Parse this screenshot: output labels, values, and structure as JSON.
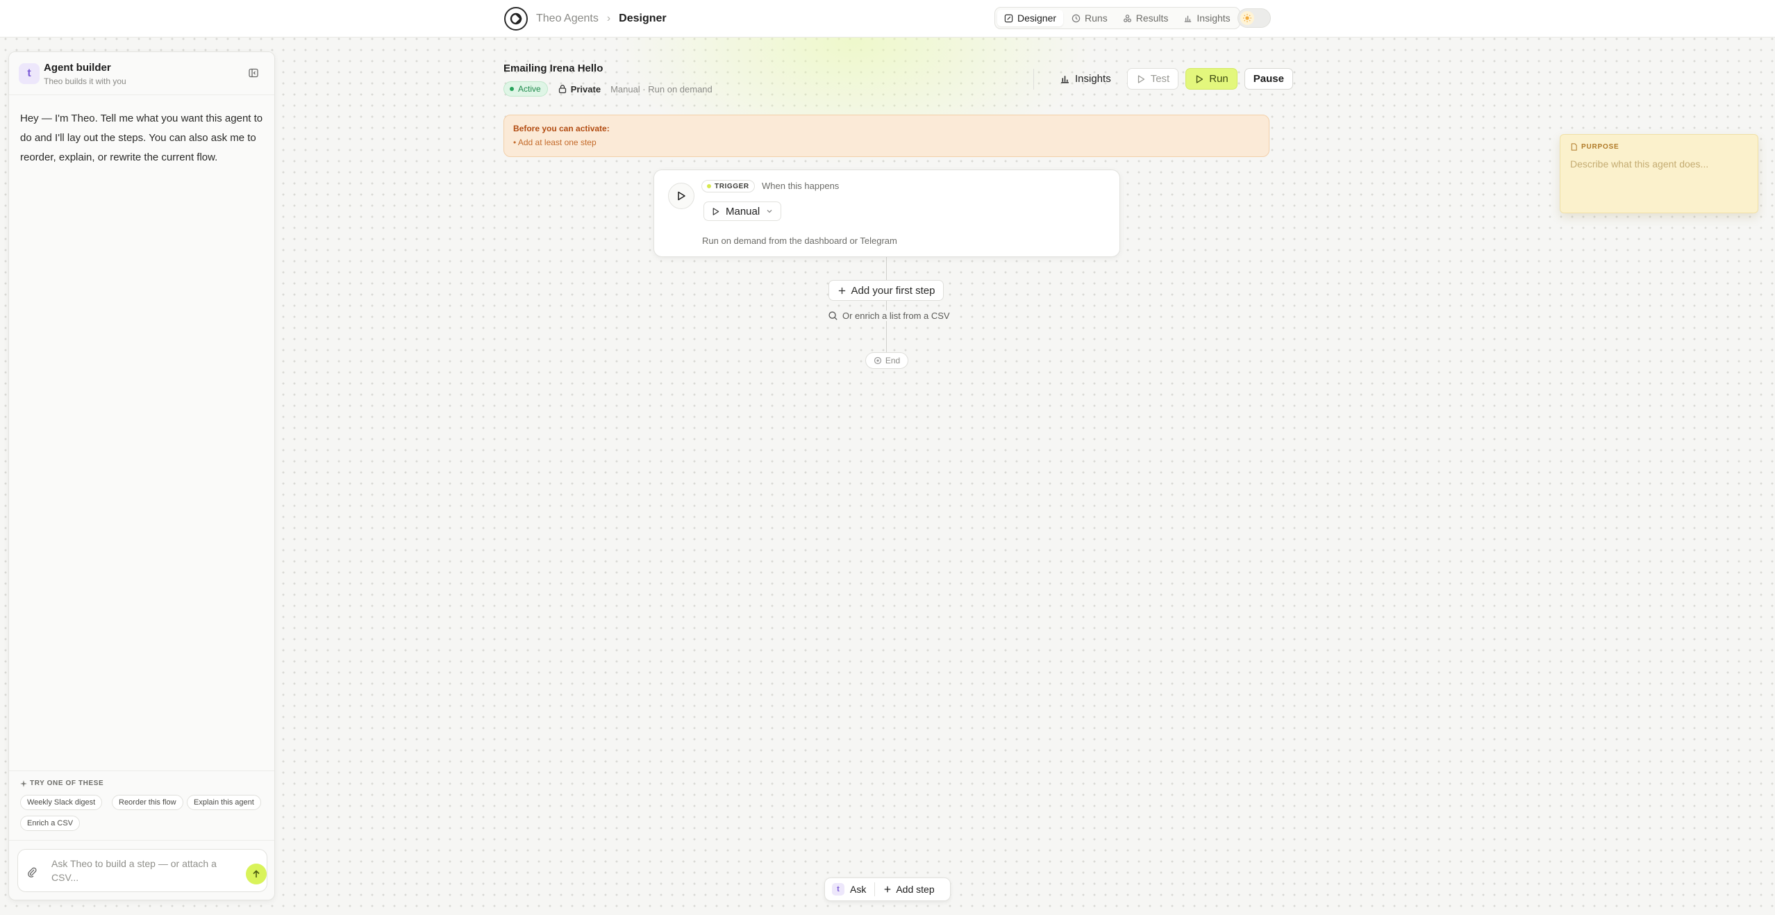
{
  "header": {
    "breadcrumb_root": "Theo Agents",
    "breadcrumb_sep": "›",
    "breadcrumb_current": "Designer",
    "tabs": [
      {
        "label": "Designer",
        "icon": "pencil-icon",
        "active": true
      },
      {
        "label": "Runs",
        "icon": "history-icon",
        "active": false
      },
      {
        "label": "Results",
        "icon": "results-icon",
        "active": false
      },
      {
        "label": "Insights",
        "icon": "bar-chart-icon",
        "active": false
      }
    ],
    "theme_icon": "sun-icon"
  },
  "builder": {
    "avatar_letter": "t",
    "title": "Agent builder",
    "subtitle": "Theo builds it with you",
    "intro": "Hey — I'm Theo. Tell me what you want this agent to do and I'll lay out the steps. You can also ask me to reorder, explain, or rewrite the current flow.",
    "suggestions_label": "TRY ONE OF THESE",
    "suggestions": [
      "Weekly Slack digest",
      "Reorder this flow",
      "Explain this agent",
      "Enrich a CSV"
    ],
    "input_placeholder": "Ask Theo to build a step — or attach a CSV...",
    "input_value": ""
  },
  "agent": {
    "name": "Emailing Irena Hello",
    "status": "Active",
    "visibility": "Private",
    "run_mode": "Manual · Run on demand",
    "actions": {
      "insights": "Insights",
      "test": "Test",
      "run": "Run",
      "pause": "Pause"
    }
  },
  "warning": {
    "title": "Before you can activate:",
    "items": [
      "• Add at least one step"
    ]
  },
  "trigger": {
    "badge": "TRIGGER",
    "when": "When this happens",
    "selected": "Manual",
    "description": "Run on demand from the dashboard or Telegram"
  },
  "flow": {
    "add_first": "Add your first step",
    "enrich": "Or enrich a list from a CSV",
    "end": "End"
  },
  "purpose": {
    "label": "PURPOSE",
    "placeholder": "Describe what this agent does...",
    "value": ""
  },
  "bottombar": {
    "ask": "Ask",
    "add_step": "Add step"
  },
  "colors": {
    "accent": "#d9f35a",
    "active_green": "#27a35a",
    "warning_bg": "#fbead7",
    "note_bg": "#fbf1cc",
    "avatar_purple": "#7b5bd6"
  }
}
